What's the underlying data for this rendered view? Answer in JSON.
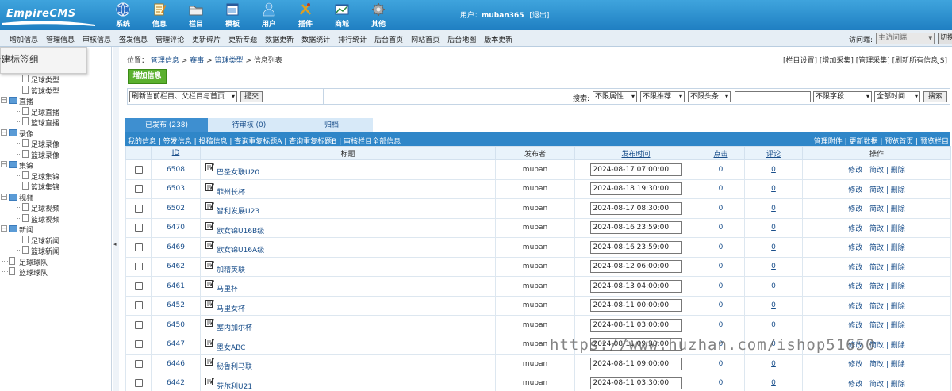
{
  "header": {
    "logo_text": "EmpireCMS",
    "nav": [
      {
        "label": "系统",
        "icon": "globe-icon"
      },
      {
        "label": "信息",
        "icon": "notepad-edit-icon"
      },
      {
        "label": "栏目",
        "icon": "folder-icon"
      },
      {
        "label": "模板",
        "icon": "template-window-icon"
      },
      {
        "label": "用户",
        "icon": "user-icon"
      },
      {
        "label": "插件",
        "icon": "tools-icon"
      },
      {
        "label": "商城",
        "icon": "shop-chart-icon"
      },
      {
        "label": "其他",
        "icon": "gear-icon"
      }
    ],
    "user_label": "用户：",
    "username": "muban365",
    "logout": "[退出]"
  },
  "subnav": {
    "items": [
      "增加信息",
      "管理信息",
      "审核信息",
      "签发信息",
      "管理评论",
      "更新碎片",
      "更新专题",
      "数据更新",
      "数据统计",
      "排行统计",
      "后台首页",
      "网站首页",
      "后台地图",
      "版本更新"
    ],
    "visit_label": "访问端:",
    "visit_value": "主访问端",
    "switch_btn": "切换"
  },
  "sidebar": {
    "popup_text": "新建标签组",
    "tree": [
      {
        "label": "足球类型",
        "level": 2
      },
      {
        "label": "篮球类型",
        "level": 2
      },
      {
        "label": "直播",
        "level": 1
      },
      {
        "label": "足球直播",
        "level": 2
      },
      {
        "label": "篮球直播",
        "level": 2
      },
      {
        "label": "录像",
        "level": 1
      },
      {
        "label": "足球录像",
        "level": 2
      },
      {
        "label": "篮球录像",
        "level": 2
      },
      {
        "label": "集锦",
        "level": 1
      },
      {
        "label": "足球集锦",
        "level": 2
      },
      {
        "label": "篮球集锦",
        "level": 2
      },
      {
        "label": "视频",
        "level": 1
      },
      {
        "label": "足球视频",
        "level": 2
      },
      {
        "label": "篮球视频",
        "level": 2
      },
      {
        "label": "新闻",
        "level": 1
      },
      {
        "label": "足球新闻",
        "level": 2
      },
      {
        "label": "篮球新闻",
        "level": 2
      },
      {
        "label": "足球球队",
        "level": 0
      },
      {
        "label": "篮球球队",
        "level": 0
      }
    ],
    "collapse_arrow": "◂"
  },
  "main": {
    "crumb_prefix": "位置：",
    "crumbs": [
      "管理信息",
      "赛事",
      "篮球类型",
      "信息列表"
    ],
    "crumb_sep": " > ",
    "right_links": "[栏目设置] [增加采集] [管理采集] [刷新所有信息JS]",
    "add_button": "增加信息",
    "refresh_select": "刷新当前栏目、父栏目与首页",
    "submit_btn": "提交",
    "search_label": "搜索:",
    "filter_attr": "不限属性",
    "filter_recommend": "不限推荐",
    "filter_headline": "不限头条",
    "search_value": "",
    "filter_field": "不限字段",
    "filter_time": "全部时间",
    "search_btn": "搜索",
    "tabs": [
      {
        "label": "已发布 (238)",
        "active": true
      },
      {
        "label": "待审核 (0)",
        "active": false
      },
      {
        "label": "归档",
        "active": false
      }
    ],
    "ops_left": "我的信息 | 签发信息 | 投稿信息 | 查询重复标题A | 查询重复标题B | 审核栏目全部信息",
    "ops_right": "管理附件 | 更新数据 | 预览首页 | 预览栏目",
    "columns": {
      "id": "ID",
      "title": "标题",
      "publisher": "发布者",
      "time": "发布时间",
      "clicks": "点击",
      "comments": "评论",
      "actions": "操作"
    },
    "action_text": "修改 | 简改 | 删除",
    "rows": [
      {
        "id": "6508",
        "title": "巴圣女联U20",
        "publisher": "muban",
        "time": "2024-08-17 07:00:00",
        "clicks": "0",
        "comments": "0"
      },
      {
        "id": "6503",
        "title": "菲州长杯",
        "publisher": "muban",
        "time": "2024-08-18 19:30:00",
        "clicks": "0",
        "comments": "0"
      },
      {
        "id": "6502",
        "title": "智利发展U23",
        "publisher": "muban",
        "time": "2024-08-17 08:30:00",
        "clicks": "0",
        "comments": "0"
      },
      {
        "id": "6470",
        "title": "欧女锦U16B级",
        "publisher": "muban",
        "time": "2024-08-16 23:59:00",
        "clicks": "0",
        "comments": "0"
      },
      {
        "id": "6469",
        "title": "欧女锦U16A级",
        "publisher": "muban",
        "time": "2024-08-16 23:59:00",
        "clicks": "0",
        "comments": "0"
      },
      {
        "id": "6462",
        "title": "加精英联",
        "publisher": "muban",
        "time": "2024-08-12 06:00:00",
        "clicks": "0",
        "comments": "0"
      },
      {
        "id": "6461",
        "title": "马里杯",
        "publisher": "muban",
        "time": "2024-08-13 04:00:00",
        "clicks": "0",
        "comments": "0"
      },
      {
        "id": "6452",
        "title": "马里女杯",
        "publisher": "muban",
        "time": "2024-08-11 00:00:00",
        "clicks": "0",
        "comments": "0"
      },
      {
        "id": "6450",
        "title": "塞内加尔杯",
        "publisher": "muban",
        "time": "2024-08-11 03:00:00",
        "clicks": "0",
        "comments": "0"
      },
      {
        "id": "6447",
        "title": "墨女ABC",
        "publisher": "muban",
        "time": "2024-08-11 09:30:00",
        "clicks": "0",
        "comments": "0"
      },
      {
        "id": "6446",
        "title": "秘鲁利马联",
        "publisher": "muban",
        "time": "2024-08-11 09:00:00",
        "clicks": "0",
        "comments": "0"
      },
      {
        "id": "6442",
        "title": "芬尔利U21",
        "publisher": "muban",
        "time": "2024-08-11 03:30:00",
        "clicks": "0",
        "comments": "0"
      }
    ]
  },
  "watermark": "https://www.huzhan.com/ishop51650"
}
